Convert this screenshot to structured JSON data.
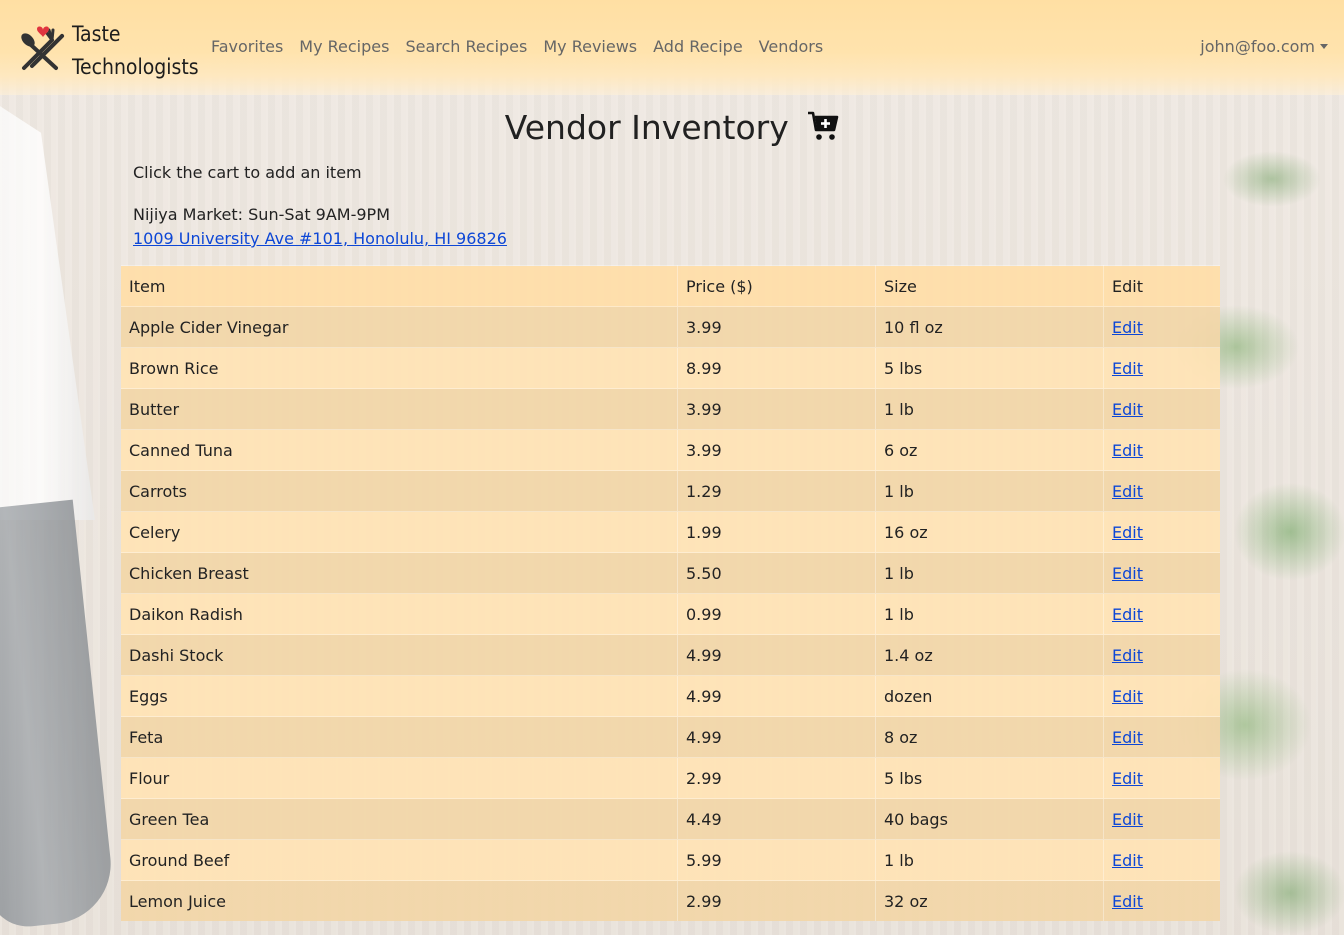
{
  "navbar": {
    "brand_line1": "Taste",
    "brand_line2": "Technologists",
    "links": [
      "Favorites",
      "My Recipes",
      "Search Recipes",
      "My Reviews",
      "Add Recipe",
      "Vendors"
    ],
    "user": "john@foo.com"
  },
  "page": {
    "title": "Vendor Inventory",
    "hint": "Click the cart to add an item",
    "vendor_hours": "Nijiya Market: Sun-Sat 9AM-9PM",
    "vendor_address": "1009 University Ave #101, Honolulu, HI 96826"
  },
  "table": {
    "headers": [
      "Item",
      "Price ($)",
      "Size",
      "Edit"
    ],
    "rows": [
      {
        "item": "Apple Cider Vinegar",
        "price": "3.99",
        "size": "10 fl oz",
        "edit": "Edit"
      },
      {
        "item": "Brown Rice",
        "price": "8.99",
        "size": "5 lbs",
        "edit": "Edit"
      },
      {
        "item": "Butter",
        "price": "3.99",
        "size": "1 lb",
        "edit": "Edit"
      },
      {
        "item": "Canned Tuna",
        "price": "3.99",
        "size": "6 oz",
        "edit": "Edit"
      },
      {
        "item": "Carrots",
        "price": "1.29",
        "size": "1 lb",
        "edit": "Edit"
      },
      {
        "item": "Celery",
        "price": "1.99",
        "size": "16 oz",
        "edit": "Edit"
      },
      {
        "item": "Chicken Breast",
        "price": "5.50",
        "size": "1 lb",
        "edit": "Edit"
      },
      {
        "item": "Daikon Radish",
        "price": "0.99",
        "size": "1 lb",
        "edit": "Edit"
      },
      {
        "item": "Dashi Stock",
        "price": "4.99",
        "size": "1.4 oz",
        "edit": "Edit"
      },
      {
        "item": "Eggs",
        "price": "4.99",
        "size": "dozen",
        "edit": "Edit"
      },
      {
        "item": "Feta",
        "price": "4.99",
        "size": "8 oz",
        "edit": "Edit"
      },
      {
        "item": "Flour",
        "price": "2.99",
        "size": "5 lbs",
        "edit": "Edit"
      },
      {
        "item": "Green Tea",
        "price": "4.49",
        "size": "40 bags",
        "edit": "Edit"
      },
      {
        "item": "Ground Beef",
        "price": "5.99",
        "size": "1 lb",
        "edit": "Edit"
      },
      {
        "item": "Lemon Juice",
        "price": "2.99",
        "size": "32 oz",
        "edit": "Edit"
      }
    ]
  },
  "icons": {
    "logo": "fork-spoon-heart-icon",
    "cart": "cart-plus-icon",
    "user_caret": "caret-down-icon"
  },
  "colors": {
    "navbar": "#ffdfa3",
    "link": "#0d47d6",
    "heart": "#e0353f"
  }
}
